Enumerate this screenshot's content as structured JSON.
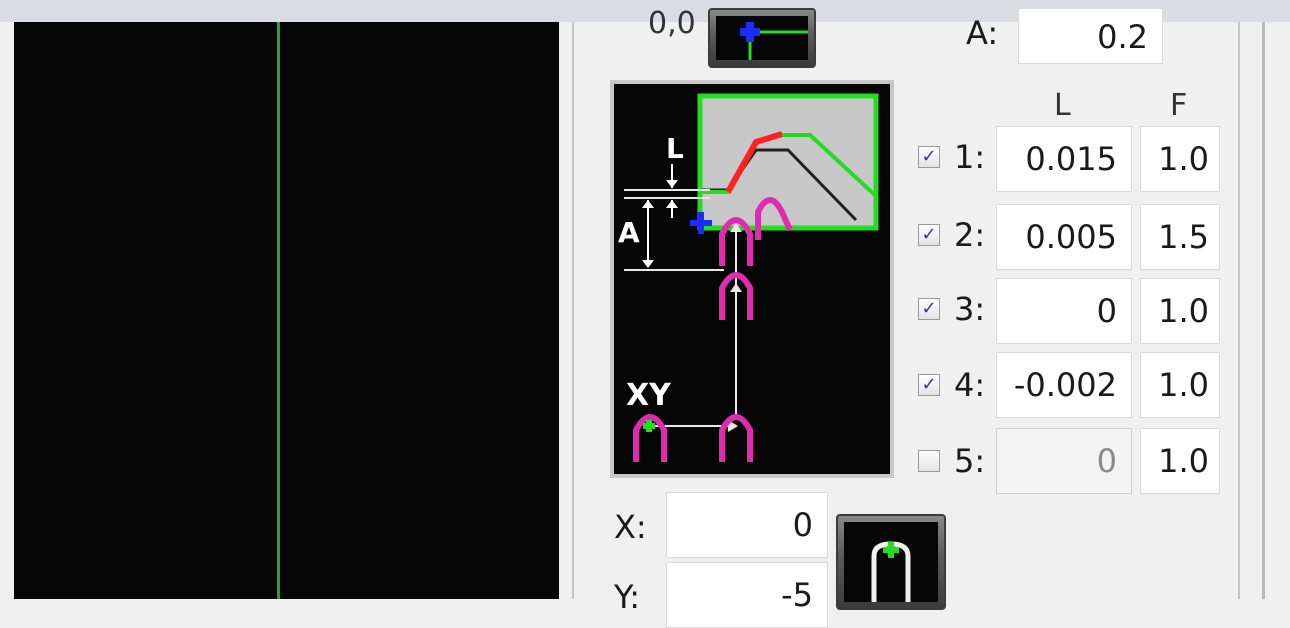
{
  "origin_label": "0,0",
  "A_label": "A:",
  "A_value": "0.2",
  "headers": {
    "L": "L",
    "F": "F"
  },
  "passes": [
    {
      "label": "1:",
      "checked": true,
      "L": "0.015",
      "F": "1.0",
      "disabled": false
    },
    {
      "label": "2:",
      "checked": true,
      "L": "0.005",
      "F": "1.5",
      "disabled": false
    },
    {
      "label": "3:",
      "checked": true,
      "L": "0",
      "F": "1.0",
      "disabled": false
    },
    {
      "label": "4:",
      "checked": true,
      "L": "-0.002",
      "F": "1.0",
      "disabled": false
    },
    {
      "label": "5:",
      "checked": false,
      "L": "0",
      "F": "1.0",
      "disabled": true
    }
  ],
  "diagram": {
    "label_L": "L",
    "label_A": "A",
    "label_XY": "XY"
  },
  "X_label": "X:",
  "X_value": "0",
  "Y_label": "Y:",
  "Y_value": "-5",
  "check_glyph": "✓",
  "colors": {
    "viewport_bg": "#060606",
    "grid_line": "#23a33a",
    "part_outline": "#22dd22",
    "cut_path": "#ff2222",
    "tool": "#e02bb0",
    "zero_marker": "#1a2cff"
  },
  "icons": {
    "origin_button": "set-zero-icon",
    "probe_button": "tool-probe-icon"
  }
}
